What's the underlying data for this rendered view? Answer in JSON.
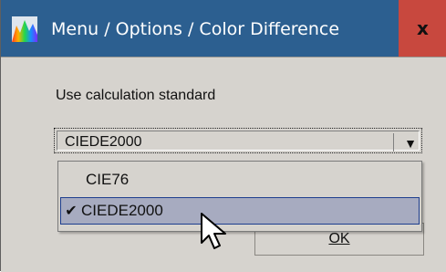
{
  "window": {
    "title": "Menu / Options / Color Difference",
    "close_label": "x",
    "icon": "spectrum-app-icon"
  },
  "form": {
    "label": "Use calculation standard",
    "combo_value": "CIEDE2000",
    "combo_arrow_icon": "triangle-down-icon",
    "ok_label": "OK"
  },
  "dropdown": {
    "options": [
      {
        "label": "CIE76",
        "selected": false
      },
      {
        "label": "CIEDE2000",
        "selected": true,
        "check": "✔"
      }
    ]
  },
  "colors": {
    "titlebar": "#2c5f90",
    "close": "#c8483e",
    "window": "#d6d3ce",
    "highlight": "#a7abc0",
    "highlight_border": "#1f3f8f"
  }
}
